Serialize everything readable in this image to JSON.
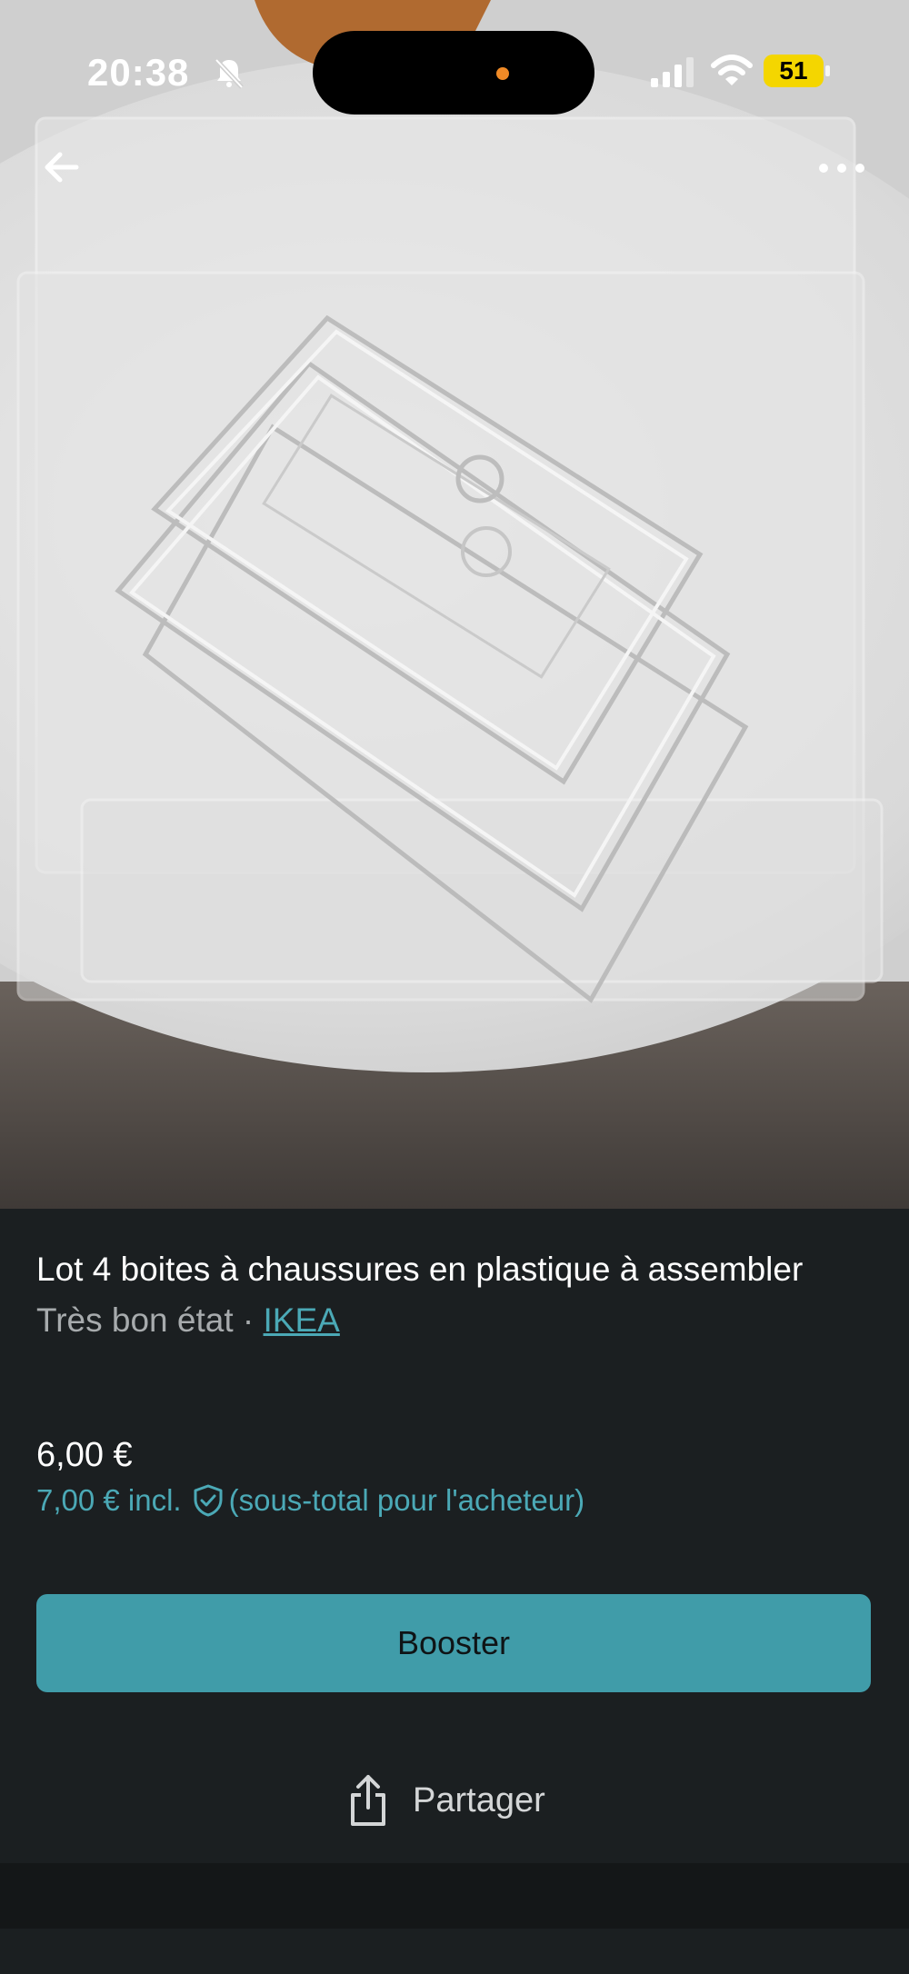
{
  "status_bar": {
    "time": "20:38",
    "battery": "51"
  },
  "icons": {
    "back": "arrow-left-icon",
    "more": "more-horizontal-icon",
    "mute": "bell-slash-icon",
    "signal": "cellular-signal-icon",
    "wifi": "wifi-icon",
    "shield": "shield-check-icon",
    "share": "share-icon"
  },
  "colors": {
    "accent": "#409ca9",
    "link": "#4ba9b6",
    "background": "#1b1f21",
    "battery": "#f4d600"
  },
  "listing": {
    "title": "Lot 4 boites à chaussures en plastique à assembler",
    "condition": "Très bon état",
    "separator": " · ",
    "brand": "IKEA",
    "price": "6,00 €",
    "price_incl": "7,00 € incl.",
    "price_incl_note": "(sous-total pour l'acheteur)"
  },
  "actions": {
    "boost_label": "Booster",
    "share_label": "Partager"
  }
}
